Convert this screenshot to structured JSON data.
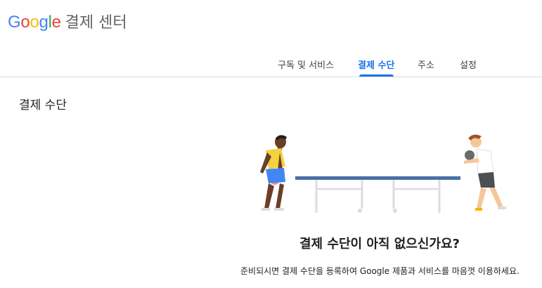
{
  "header": {
    "logo_letters": [
      "G",
      "o",
      "o",
      "g",
      "l",
      "e"
    ],
    "logo_colors": [
      "#4285F4",
      "#EA4335",
      "#FBBC05",
      "#4285F4",
      "#34A853",
      "#EA4335"
    ],
    "product_name": "결제 센터"
  },
  "tabs": [
    {
      "label": "구독 및 서비스",
      "active": false
    },
    {
      "label": "결제 수단",
      "active": true
    },
    {
      "label": "주소",
      "active": false
    },
    {
      "label": "설정",
      "active": false
    }
  ],
  "accent_color": "#1a73e8",
  "main": {
    "section_title": "결제 수단",
    "illustration": "ping-pong-players-illustration",
    "empty_state": {
      "title": "결제 수단이 아직 없으신가요?",
      "description": "준비되시면 결제 수단을 등록하여 Google 제품과 서비스를 마음껏 이용하세요."
    }
  }
}
